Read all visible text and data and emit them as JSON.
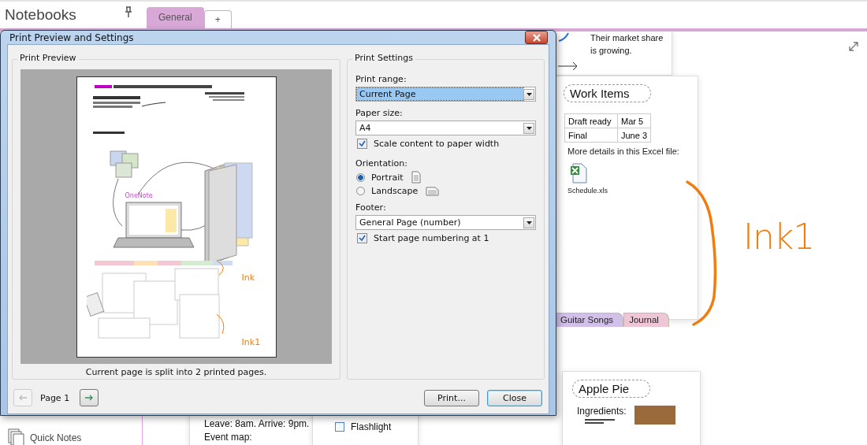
{
  "app": {
    "title": "Notebooks",
    "tabs": [
      {
        "label": "General",
        "selected": true
      },
      {
        "label": "+",
        "selected": false
      }
    ],
    "sidebar": {
      "items": [
        {
          "label": "Quick Notes"
        }
      ]
    }
  },
  "canvas": {
    "market_note": "Their market share is growing.",
    "work_items": {
      "title": "Work Items",
      "rows": [
        [
          "Draft ready",
          "Mar 5"
        ],
        [
          "Final",
          "June 3"
        ]
      ],
      "note": "More details in this Excel file:",
      "attachment": "Schedule.xls"
    },
    "section_tabs": [
      {
        "label": "Guitar Songs",
        "color": "#d2bfea"
      },
      {
        "label": "Journal",
        "color": "#efc6d6"
      }
    ],
    "ink": "Ink1",
    "apple_pie": {
      "title": "Apple Pie",
      "heading": "Ingredients:"
    },
    "trip_note": {
      "line": "Leave: 8am. Arrive: 9pm.",
      "cut_line": "Event map:"
    },
    "checklist": [
      {
        "label": "Flashlight",
        "checked": false
      }
    ]
  },
  "dialog": {
    "title": "Print Preview and Settings",
    "preview": {
      "legend": "Print Preview",
      "page": {
        "laptop_label": "OneNote",
        "ink_top": "Ink",
        "ink_bottom": "Ink1"
      },
      "caption": "Current page is split into 2 printed pages."
    },
    "settings": {
      "legend": "Print Settings",
      "fields": [
        {
          "kind": "select",
          "label": "Print range:",
          "value": "Current Page",
          "highlighted": true
        },
        {
          "kind": "select",
          "label": "Paper size:",
          "value": "A4",
          "highlighted": false
        },
        {
          "kind": "checkbox",
          "label": "Scale content to paper width",
          "checked": true
        },
        {
          "kind": "heading",
          "label": "Orientation:"
        },
        {
          "kind": "radio",
          "label": "Portrait",
          "selected": true
        },
        {
          "kind": "radio",
          "label": "Landscape",
          "selected": false
        },
        {
          "kind": "select",
          "label": "Footer:",
          "value": "General Page (number)",
          "highlighted": false
        },
        {
          "kind": "checkbox",
          "label": "Start page numbering at 1",
          "checked": true
        }
      ]
    },
    "pager": {
      "label": "Page 1",
      "prev_disabled": true,
      "next_disabled": false
    },
    "buttons": [
      {
        "label": "Print...",
        "default": false
      },
      {
        "label": "Close",
        "default": true
      }
    ]
  }
}
